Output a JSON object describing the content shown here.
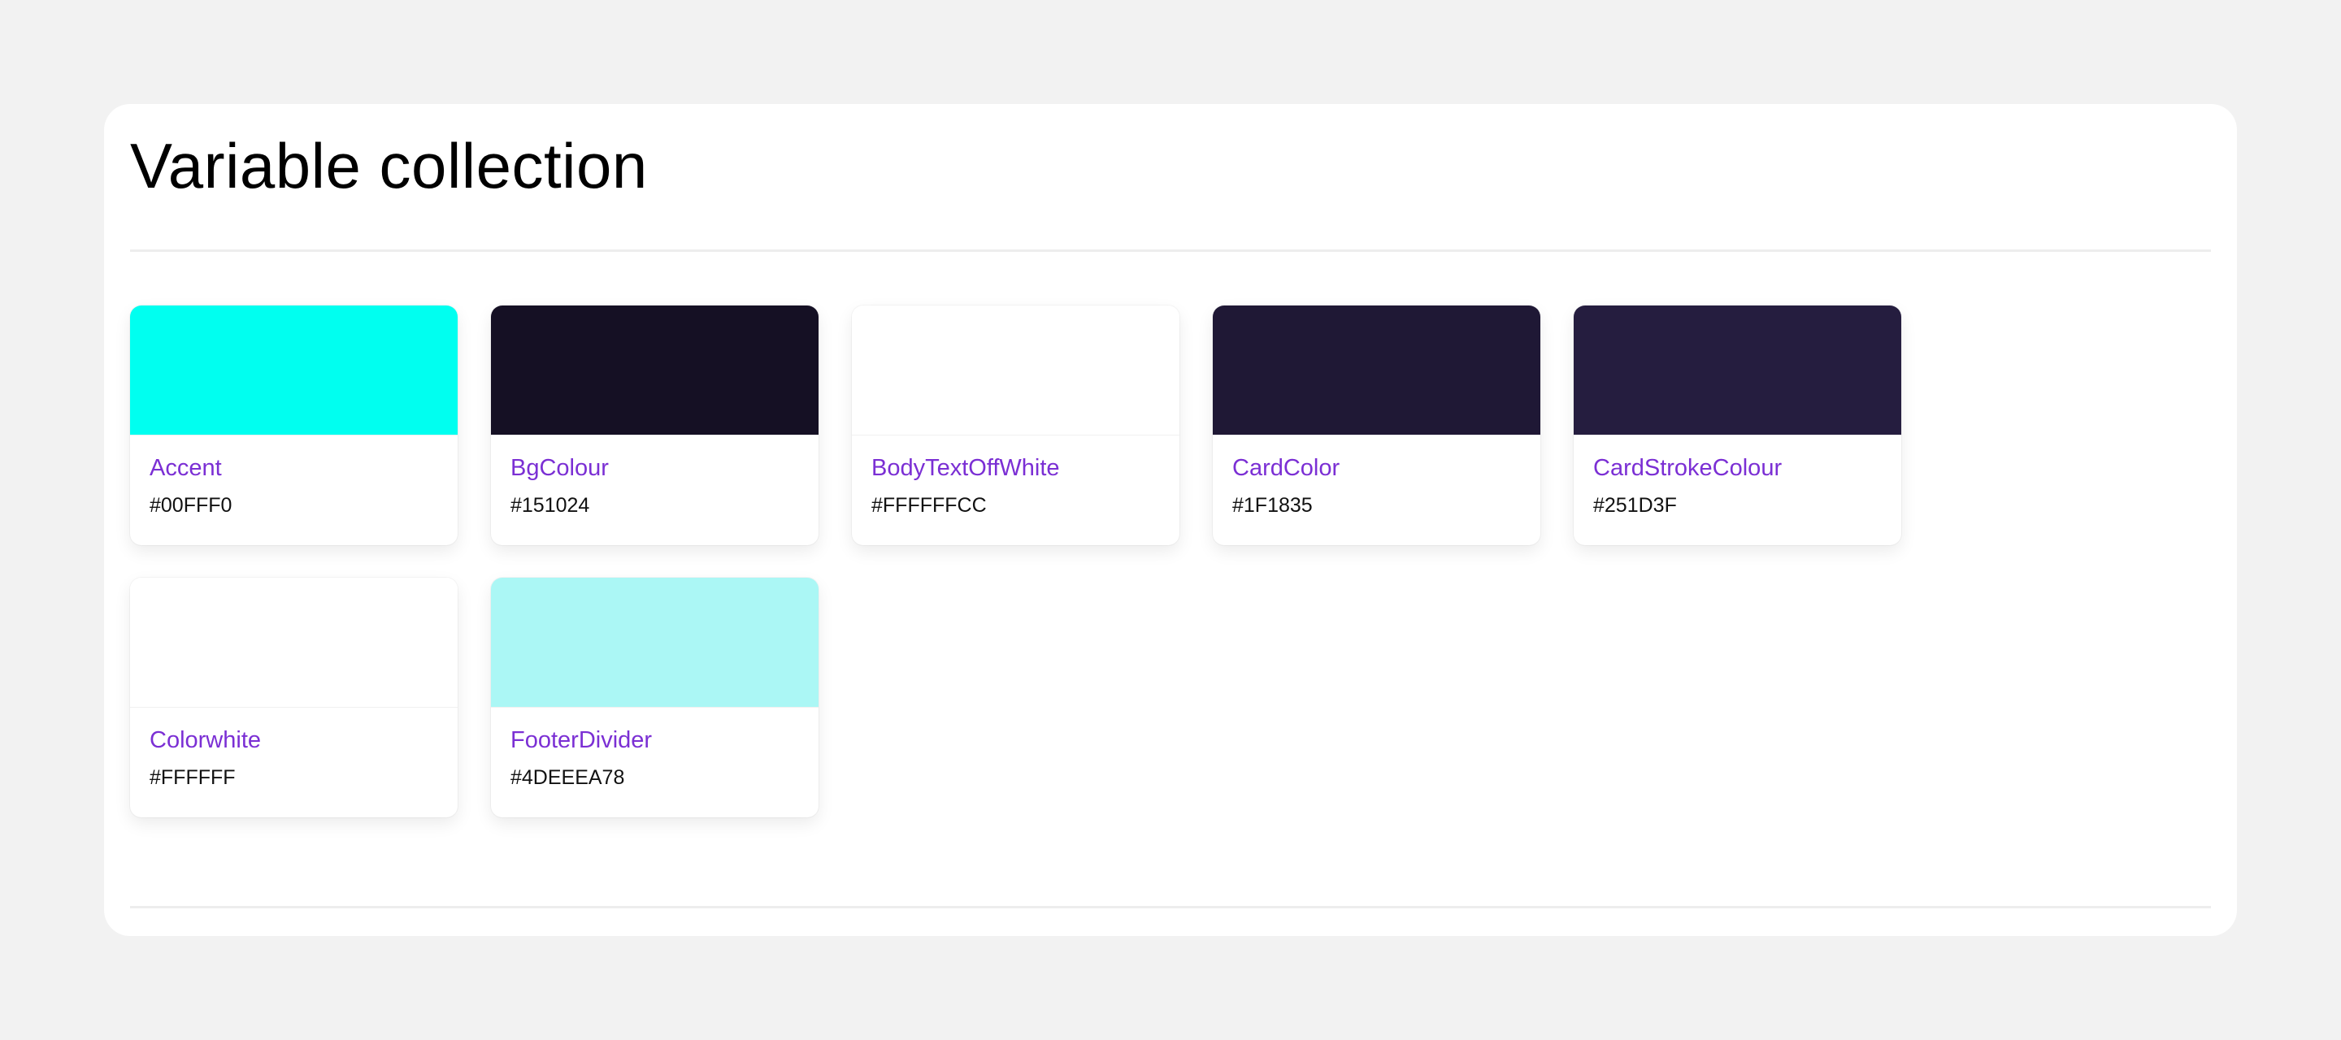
{
  "page": {
    "title": "Variable collection"
  },
  "variables": [
    {
      "name": "Accent",
      "hex": "#00FFF0",
      "color": "#00FFF0"
    },
    {
      "name": "BgColour",
      "hex": "#151024",
      "color": "#151024"
    },
    {
      "name": "BodyTextOffWhite",
      "hex": "#FFFFFFCC",
      "color": "#FFFFFFCC"
    },
    {
      "name": "CardColor",
      "hex": "#1F1835",
      "color": "#1F1835"
    },
    {
      "name": "CardStrokeColour",
      "hex": "#251D3F",
      "color": "#251D3F"
    },
    {
      "name": "Colorwhite",
      "hex": "#FFFFFF",
      "color": "#FFFFFF"
    },
    {
      "name": "FooterDivider",
      "hex": "#4DEEEA78",
      "color": "#4DEEEA78"
    }
  ]
}
